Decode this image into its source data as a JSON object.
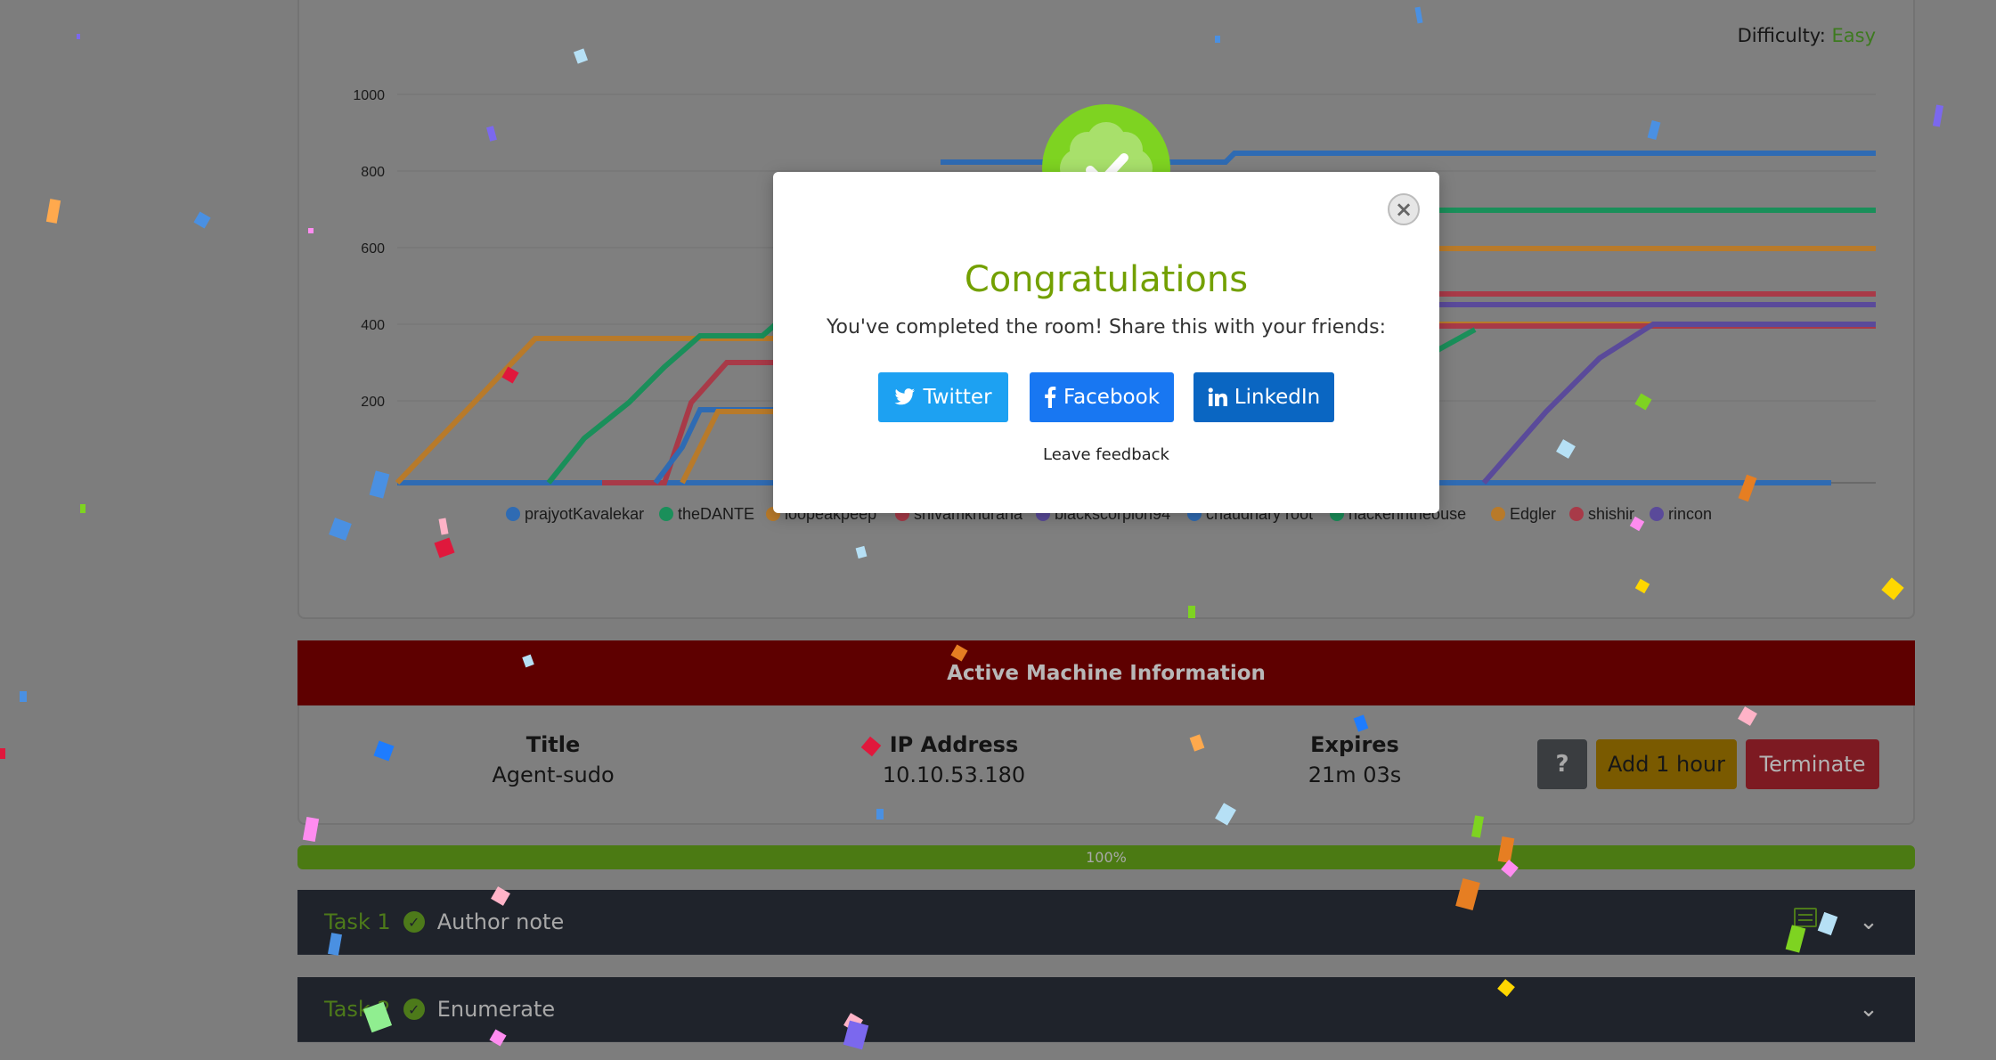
{
  "room": {
    "difficulty_label": "Difficulty:",
    "difficulty_value": "Easy"
  },
  "chart_data": {
    "type": "line",
    "ylim": [
      0,
      1000
    ],
    "yticks": [
      "1000",
      "800",
      "600",
      "400",
      "200"
    ],
    "series": [
      {
        "name": "prajyotKavalekar",
        "color": "#2f6bb3"
      },
      {
        "name": "theDANTE",
        "color": "#1a8f5a"
      },
      {
        "name": "loopeakpeep",
        "color": "#b87a2a"
      },
      {
        "name": "shivamkhurana",
        "color": "#a83a48"
      },
      {
        "name": "blackscorpion94",
        "color": "#5a4a9a"
      },
      {
        "name": "chaudhary root",
        "color": "#2f6bb3"
      },
      {
        "name": "hackerintheouse",
        "color": "#1a8f5a"
      },
      {
        "name": "Edgler",
        "color": "#b87a2a"
      },
      {
        "name": "shishir",
        "color": "#a83a48"
      },
      {
        "name": "rincon",
        "color": "#5a4a9a"
      }
    ]
  },
  "machine": {
    "header": "Active Machine Information",
    "title_label": "Title",
    "title_value": "Agent-sudo",
    "ip_label": "IP Address",
    "ip_value": "10.10.53.180",
    "expires_label": "Expires",
    "expires_value": "21m 03s",
    "help_label": "?",
    "add_hour_label": "Add 1 hour",
    "terminate_label": "Terminate"
  },
  "progress": {
    "percent_text": "100%",
    "value": 1.0
  },
  "tasks": [
    {
      "number": "Task 1",
      "title": "Author note"
    },
    {
      "number": "Task 2",
      "title": "Enumerate"
    }
  ],
  "modal": {
    "title": "Congratulations",
    "text": "You've completed the room! Share this with your friends:",
    "twitter_label": "Twitter",
    "facebook_label": "Facebook",
    "linkedin_label": "LinkedIn",
    "feedback_label": "Leave feedback",
    "close_symbol": "×",
    "accent_color": "#7ed321"
  }
}
